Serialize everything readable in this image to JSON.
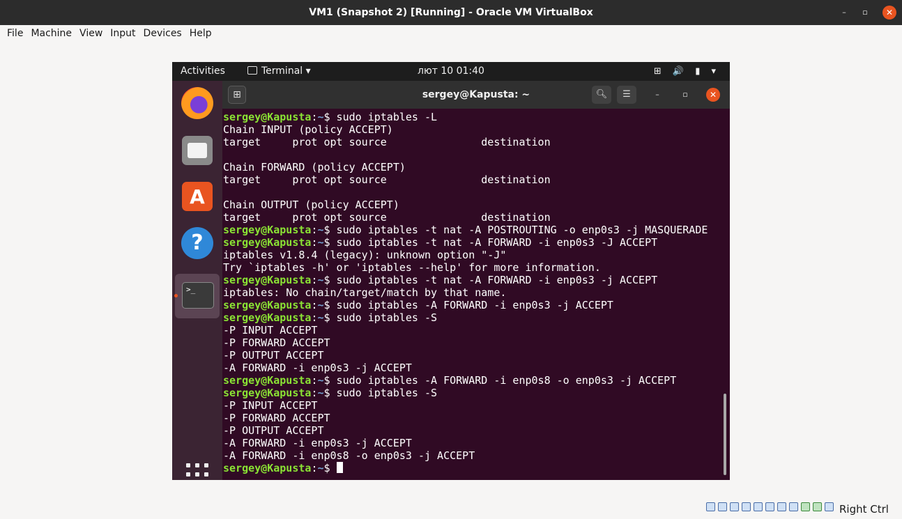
{
  "window": {
    "title": "VM1 (Snapshot 2) [Running] - Oracle VM VirtualBox",
    "minimize": "–",
    "maximize": "▫",
    "close": "✕"
  },
  "menubar": {
    "items": [
      "File",
      "Machine",
      "View",
      "Input",
      "Devices",
      "Help"
    ]
  },
  "guest_topbar": {
    "activities": "Activities",
    "app_menu": "Terminal ▾",
    "clock": "лют 10  01:40",
    "tray": "⊞ 🔊 ▮ ▾"
  },
  "dock": {
    "items": [
      "firefox-icon",
      "files-icon",
      "software-icon",
      "help-icon",
      "terminal-icon",
      "show-apps-icon"
    ],
    "terminal_glyph": ">_"
  },
  "terminal": {
    "title": "sergey@Kapusta: ~",
    "prompt_user": "sergey@Kapusta",
    "prompt_path": "~",
    "lines": [
      {
        "t": "p",
        "cmd": " sudo iptables -L"
      },
      {
        "t": "o",
        "text": "Chain INPUT (policy ACCEPT)"
      },
      {
        "t": "o",
        "text": "target     prot opt source               destination"
      },
      {
        "t": "o",
        "text": ""
      },
      {
        "t": "o",
        "text": "Chain FORWARD (policy ACCEPT)"
      },
      {
        "t": "o",
        "text": "target     prot opt source               destination"
      },
      {
        "t": "o",
        "text": ""
      },
      {
        "t": "o",
        "text": "Chain OUTPUT (policy ACCEPT)"
      },
      {
        "t": "o",
        "text": "target     prot opt source               destination"
      },
      {
        "t": "p",
        "cmd": " sudo iptables -t nat -A POSTROUTING -o enp0s3 -j MASQUERADE"
      },
      {
        "t": "p",
        "cmd": " sudo iptables -t nat -A FORWARD -i enp0s3 -J ACCEPT"
      },
      {
        "t": "o",
        "text": "iptables v1.8.4 (legacy): unknown option \"-J\""
      },
      {
        "t": "o",
        "text": "Try `iptables -h' or 'iptables --help' for more information."
      },
      {
        "t": "p",
        "cmd": " sudo iptables -t nat -A FORWARD -i enp0s3 -j ACCEPT"
      },
      {
        "t": "o",
        "text": "iptables: No chain/target/match by that name."
      },
      {
        "t": "p",
        "cmd": " sudo iptables -A FORWARD -i enp0s3 -j ACCEPT"
      },
      {
        "t": "p",
        "cmd": " sudo iptables -S"
      },
      {
        "t": "o",
        "text": "-P INPUT ACCEPT"
      },
      {
        "t": "o",
        "text": "-P FORWARD ACCEPT"
      },
      {
        "t": "o",
        "text": "-P OUTPUT ACCEPT"
      },
      {
        "t": "o",
        "text": "-A FORWARD -i enp0s3 -j ACCEPT"
      },
      {
        "t": "p",
        "cmd": " sudo iptables -A FORWARD -i enp0s8 -o enp0s3 -j ACCEPT"
      },
      {
        "t": "p",
        "cmd": " sudo iptables -S"
      },
      {
        "t": "o",
        "text": "-P INPUT ACCEPT"
      },
      {
        "t": "o",
        "text": "-P FORWARD ACCEPT"
      },
      {
        "t": "o",
        "text": "-P OUTPUT ACCEPT"
      },
      {
        "t": "o",
        "text": "-A FORWARD -i enp0s3 -j ACCEPT"
      },
      {
        "t": "o",
        "text": "-A FORWARD -i enp0s8 -o enp0s3 -j ACCEPT"
      },
      {
        "t": "p",
        "cmd": " ",
        "cursor": true
      }
    ]
  },
  "statusbar": {
    "host_key": "Right Ctrl",
    "icons": [
      "hard-disk-icon",
      "optical-drive-icon",
      "audio-icon",
      "network-icon",
      "usb-icon",
      "shared-folders-icon",
      "display-icon",
      "video-capture-icon",
      "virtualization-icon",
      "cpu-icon",
      "mouse-integration-icon"
    ]
  },
  "colors": {
    "terminal_bg": "#300a24",
    "prompt_user": "#8ae234",
    "prompt_path": "#729fcf",
    "accent": "#e95420"
  }
}
